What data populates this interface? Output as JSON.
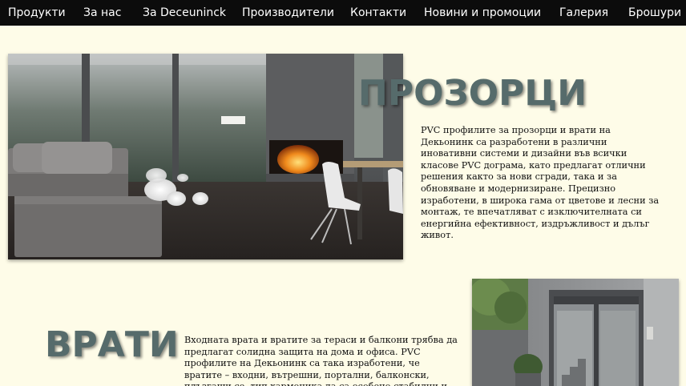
{
  "nav": {
    "items": [
      {
        "label": "Продукти"
      },
      {
        "label": "За нас"
      },
      {
        "label": "За Deceuninck"
      },
      {
        "label": "Производители"
      },
      {
        "label": "Контакти"
      },
      {
        "label": "Новини и промоции"
      },
      {
        "label": "Галерия"
      },
      {
        "label": "Брошури"
      }
    ]
  },
  "windows": {
    "heading": "ПРОЗОРЦИ",
    "text": "PVC профилите за прозорци и врати на Декьонинк са разработени в различни иновативни системи и дизайни във всички класове PVC дограма, като предлагат отлични решения както за нови сгради, така и за обновяване и модернизиране. Прецизно изработени, в широка гама от цветове и лесни за монтаж, те впечатляват с изключителната си енергийна ефективност, издръжливост и дълъг живот."
  },
  "doors": {
    "heading": "ВРАТИ",
    "text": "Входната врата и вратите за тераси и балкони трябва да предлагат солидна защита на дома и офиса. PVC профилите на Декьонинк са така изработени, че вратите – входни, вътрешни, портални, балконски, плъзгащи се, тип хармоника да са особено стабилни и здрави."
  },
  "colors": {
    "background": "#fefce8",
    "nav_bg": "#0c0c0c",
    "heading": "#566b6b"
  }
}
